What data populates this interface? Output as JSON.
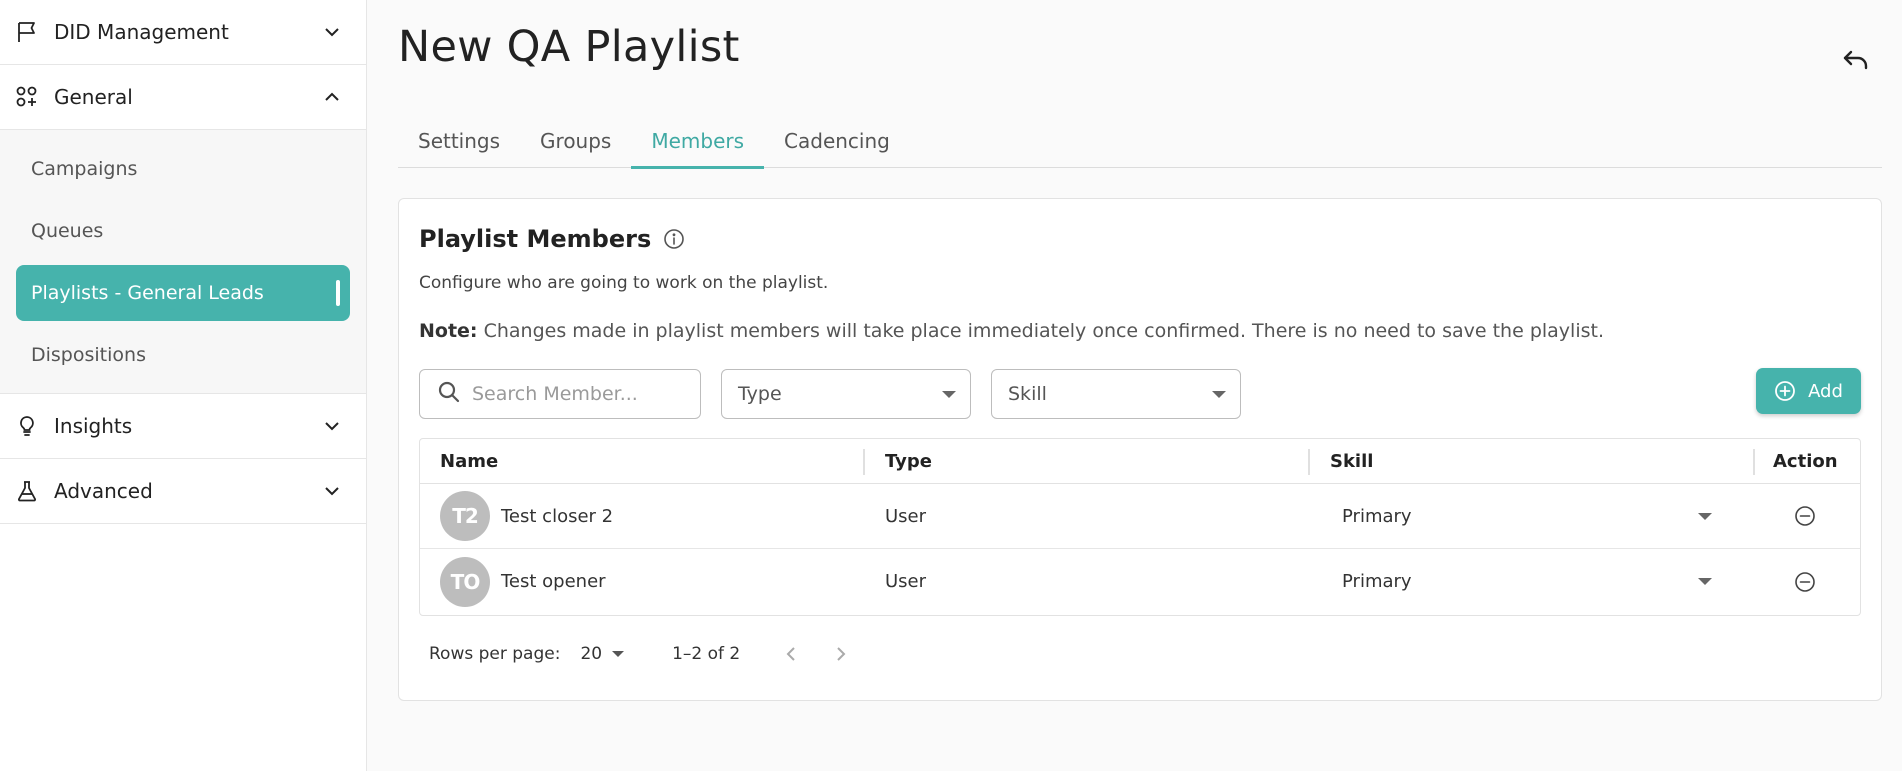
{
  "sidebar": {
    "sections": [
      {
        "label": "DID Management",
        "icon": "flag-icon",
        "expanded": false
      },
      {
        "label": "General",
        "icon": "apps-add-icon",
        "expanded": true
      },
      {
        "label": "Insights",
        "icon": "lightbulb-icon",
        "expanded": false
      },
      {
        "label": "Advanced",
        "icon": "flask-icon",
        "expanded": false
      }
    ],
    "general_items": [
      {
        "label": "Campaigns"
      },
      {
        "label": "Queues"
      },
      {
        "label": "Playlists - General Leads",
        "active": true
      },
      {
        "label": "Dispositions"
      }
    ]
  },
  "page": {
    "title": "New QA Playlist"
  },
  "tabs": [
    {
      "label": "Settings"
    },
    {
      "label": "Groups"
    },
    {
      "label": "Members",
      "active": true
    },
    {
      "label": "Cadencing"
    }
  ],
  "members_card": {
    "title": "Playlist Members",
    "description": "Configure who are going to work on the playlist.",
    "note_label": "Note:",
    "note_text": " Changes made in playlist members will take place immediately once confirmed. There is no need to save the playlist.",
    "search_placeholder": "Search Member...",
    "type_filter": "Type",
    "skill_filter": "Skill",
    "add_label": "Add"
  },
  "table": {
    "headers": {
      "name": "Name",
      "type": "Type",
      "skill": "Skill",
      "action": "Action"
    },
    "rows": [
      {
        "initials": "T2",
        "name": "Test closer 2",
        "type": "User",
        "skill": "Primary"
      },
      {
        "initials": "TO",
        "name": "Test opener",
        "type": "User",
        "skill": "Primary"
      }
    ]
  },
  "pagination": {
    "rows_per_page_label": "Rows per page:",
    "rows_per_page": "20",
    "range": "1–2 of 2"
  },
  "colors": {
    "accent": "#46b3ac",
    "accent_text": "#3fa9a3",
    "avatar_bg": "#bdbdbd"
  }
}
